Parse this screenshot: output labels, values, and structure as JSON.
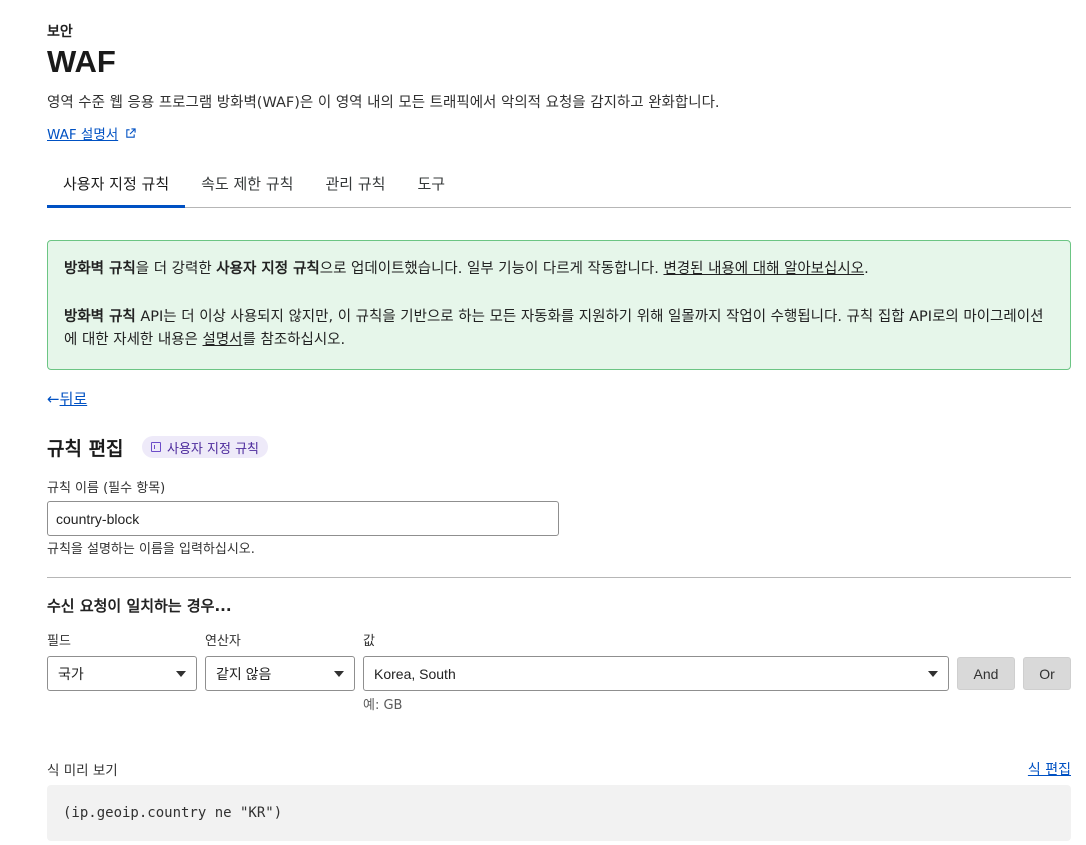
{
  "header": {
    "section": "보안",
    "title": "WAF",
    "description": "영역 수준 웹 응용 프로그램 방화벽(WAF)은 이 영역 내의 모든 트래픽에서 악의적 요청을 감지하고 완화합니다.",
    "doc_link": "WAF 설명서"
  },
  "tabs": [
    {
      "label": "사용자 지정 규칙",
      "active": true
    },
    {
      "label": "속도 제한 규칙",
      "active": false
    },
    {
      "label": "관리 규칙",
      "active": false
    },
    {
      "label": "도구",
      "active": false
    }
  ],
  "banner": {
    "p1_bold1": "방화벽 규칙",
    "p1_text1": "을 더 강력한 ",
    "p1_bold2": "사용자 지정 규칙",
    "p1_text2": "으로 업데이트했습니다. 일부 기능이 다르게 작동합니다. ",
    "p1_link": "변경된 내용에 대해 알아보십시오",
    "p1_end": ".",
    "p2_bold": "방화벽 규칙",
    "p2_text1": " API는 더 이상 사용되지 않지만, 이 규칙을 기반으로 하는 모든 자동화를 지원하기 위해 일몰까지 작업이 수행됩니다. 규칙 집합 API로의 마이그레이션에 대한 자세한 내용은 ",
    "p2_link": "설명서",
    "p2_text2": "를 참조하십시오."
  },
  "back": {
    "arrow": "←",
    "label": "뒤로"
  },
  "editor": {
    "title": "규칙 편집",
    "badge": "사용자 지정 규칙",
    "name_label": "규칙 이름 (필수 항목)",
    "name_value": "country-block",
    "name_help": "규칙을 설명하는 이름을 입력하십시오.",
    "when_title": "수신 요청이 일치하는 경우...",
    "field_label": "필드",
    "operator_label": "연산자",
    "value_label": "값",
    "field_value": "국가",
    "operator_value": "같지 않음",
    "value_value": "Korea, South",
    "value_help": "예: GB",
    "and_button": "And",
    "or_button": "Or",
    "preview_label": "식 미리 보기",
    "edit_expression": "식 편집",
    "expression": "(ip.geoip.country ne \"KR\")"
  },
  "colors": {
    "link": "#0051c3",
    "banner_bg": "#e6f6ea",
    "banner_border": "#6cc584",
    "badge_bg": "#eeeaf9"
  }
}
